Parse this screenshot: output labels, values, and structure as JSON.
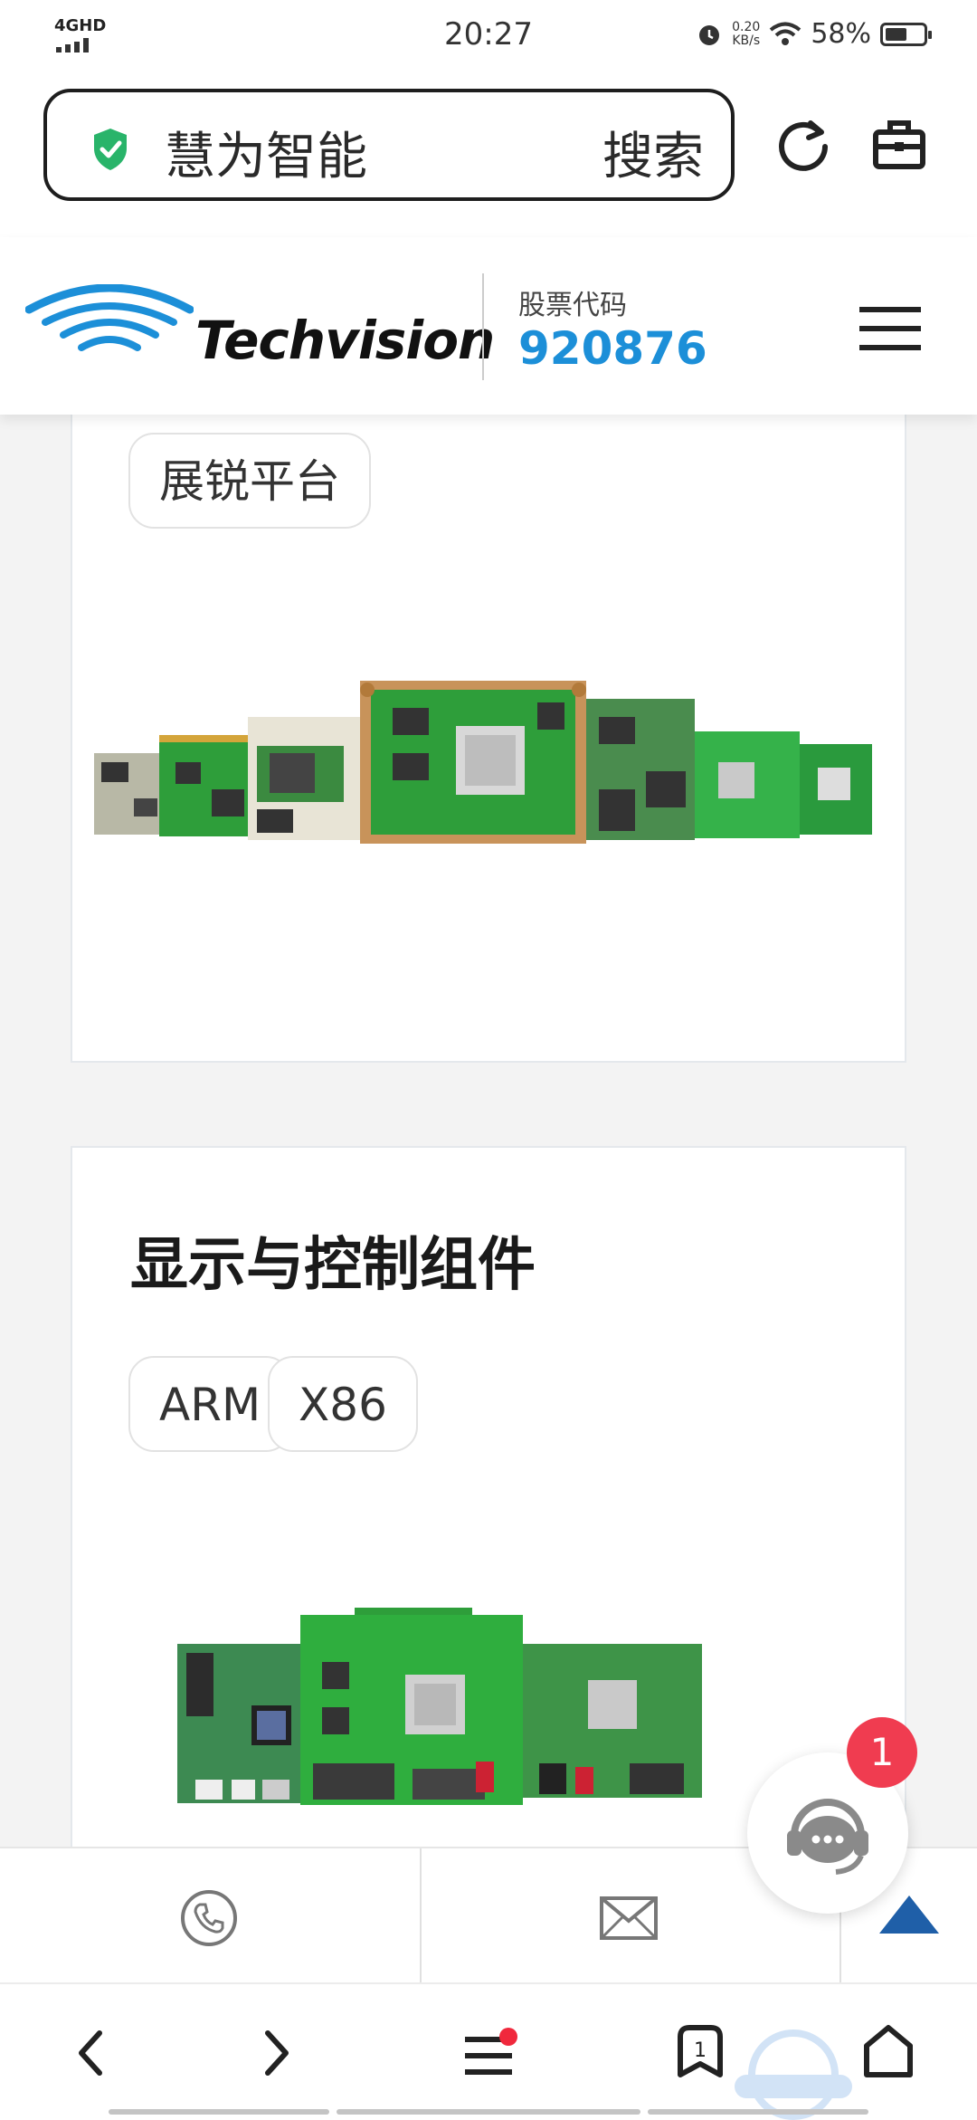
{
  "status_bar": {
    "network": "4GHD",
    "time": "20:27",
    "speed_value": "0.20",
    "speed_unit": "KB/s",
    "battery_text": "58%",
    "battery_level": 0.58
  },
  "address_bar": {
    "query": "慧为智能",
    "search_button": "搜索"
  },
  "site_header": {
    "logo_text": "Techvision",
    "stock_label": "股票代码",
    "stock_code": "920876"
  },
  "cards": [
    {
      "chips": [
        "展锐平台"
      ]
    },
    {
      "title": "显示与控制组件",
      "chips": [
        "ARM",
        "X86"
      ]
    }
  ],
  "chat": {
    "badge_count": "1"
  },
  "colors": {
    "accent_blue": "#1c8fd8",
    "badge_red": "#f03c50",
    "pcb_green": "#2e9e3a",
    "back_top_blue": "#1f5fa8"
  },
  "icons": [
    "shield-check-icon",
    "refresh-icon",
    "toolbox-icon",
    "menu-icon",
    "phone-icon",
    "mail-icon",
    "back-to-top-icon",
    "chat-support-icon",
    "back-icon",
    "forward-icon",
    "tabs-menu-icon",
    "bookmark-icon",
    "home-icon"
  ]
}
